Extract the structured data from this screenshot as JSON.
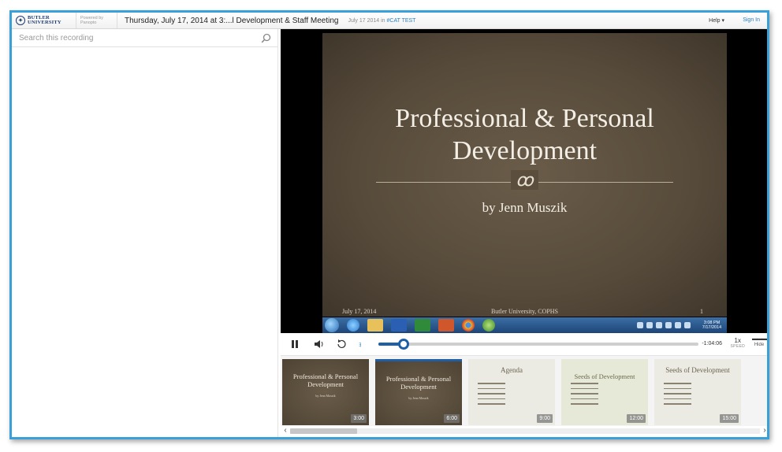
{
  "header": {
    "logo_text": "BUTLER UNIVERSITY",
    "powered_by": "Powered by Panopto",
    "title": "Thursday, July 17, 2014 at 3:...l Development & Staff Meeting",
    "meta_date": "July 17 2014 in",
    "meta_folder": "#CAT TEST",
    "help_label": "Help ▾",
    "signin_label": "Sign In"
  },
  "search": {
    "placeholder": "Search this recording",
    "icon": "search-icon"
  },
  "slide": {
    "title": "Professional & Personal Development",
    "flourish": "cვ",
    "author": "by Jenn Muszik",
    "footer_date": "July 17, 2014",
    "footer_institution": "Butler University, COPHS",
    "footer_page": "1",
    "taskbar_clock": "3:08 PM 7/17/2014"
  },
  "controls": {
    "pause_icon": "pause-icon",
    "volume_icon": "volume-icon",
    "rewind_icon": "rewind-icon",
    "live_label": "ﾖ",
    "progress_fraction": 0.08,
    "time_remaining": "-1:04:06",
    "speed_value": "1x",
    "speed_label": "SPEED",
    "hide_label": "Hide"
  },
  "thumbnails": [
    {
      "title": "Professional & Personal Development",
      "sub": "by Jenn Muszik",
      "time": "3:00",
      "style": "dark",
      "active": false
    },
    {
      "title": "Professional & Personal Development",
      "sub": "by Jenn Muszik",
      "time": "6:00",
      "style": "dark",
      "active": true
    },
    {
      "title": "Agenda",
      "sub": "",
      "time": "9:00",
      "style": "light",
      "active": false
    },
    {
      "title": "Seeds of Development",
      "sub": "",
      "time": "12:00",
      "style": "green",
      "active": false
    },
    {
      "title": "Seeds of Development",
      "sub": "",
      "time": "15:00",
      "style": "light",
      "active": false
    }
  ],
  "colors": {
    "frame_border": "#3aa0d8",
    "accent_blue": "#1f5fa5",
    "slide_brown": "#564a3a"
  }
}
